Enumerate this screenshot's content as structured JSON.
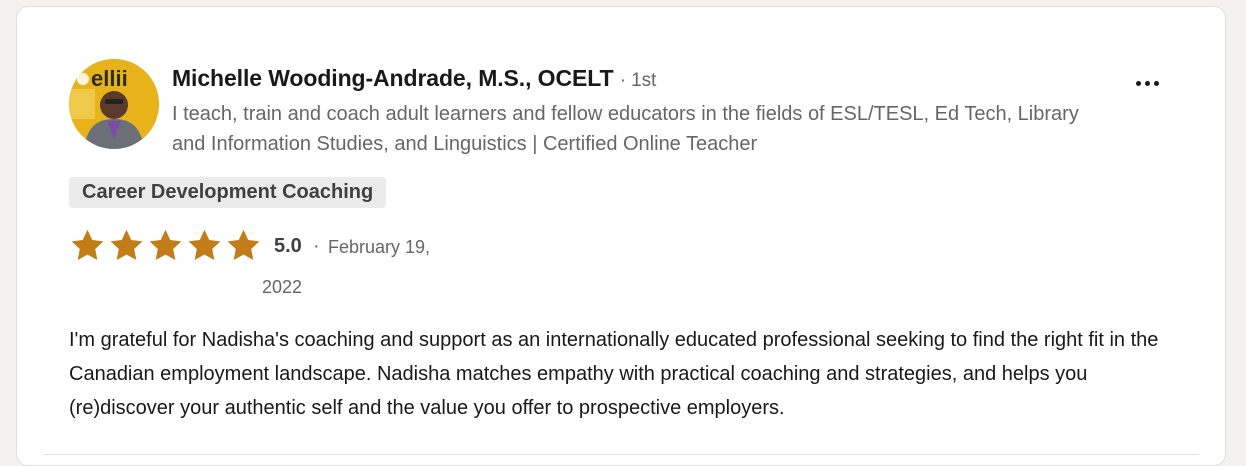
{
  "reviewer": {
    "name": "Michelle Wooding-Andrade, M.S., OCELT",
    "connection_degree": "· 1st",
    "headline": "I teach, train and coach adult learners and fellow educators in the fields of ESL/TESL, Ed Tech, Library and Information Studies, and Linguistics | Certified Online Teacher",
    "avatar": {
      "logo_text": "ellii",
      "icon": "avatar-photo"
    }
  },
  "menu": {
    "icon": "more-horizontal-icon"
  },
  "review": {
    "service": "Career Development Coaching",
    "rating": "5.0",
    "rating_fraction": 1.0,
    "stars": 5,
    "separator": "·",
    "date": "February 19, 2022",
    "text": "I'm grateful for Nadisha's coaching and support as an internationally educated professional seeking to find the right fit in the Canadian employment landscape. Nadisha matches empathy with practical coaching and strategies, and helps you (re)discover your authentic self and the value you offer to prospective employers."
  },
  "colors": {
    "star": "#c37d16",
    "avatar_bg": "#e8b21a",
    "text_primary": "#191919",
    "text_secondary": "#666666",
    "tag_bg": "#ebebeb"
  }
}
